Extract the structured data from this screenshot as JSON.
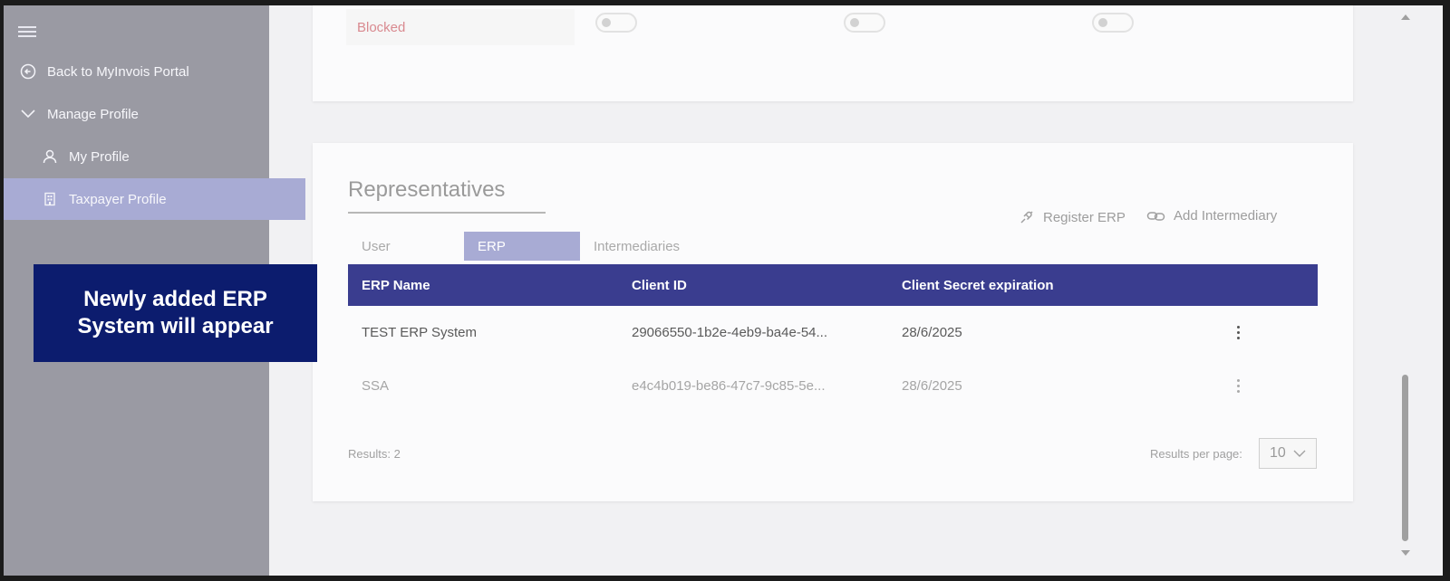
{
  "sidebar": {
    "menu_icon": "hamburger-icon",
    "items": [
      {
        "label": "Back to MyInvois Portal",
        "icon": "back-circle-icon"
      },
      {
        "label": "Manage Profile",
        "icon": "chevron-down-icon"
      },
      {
        "label": "My Profile",
        "icon": "person-icon"
      },
      {
        "label": "Taxpayer Profile",
        "icon": "building-icon"
      }
    ]
  },
  "caption": {
    "text": "Newly added ERP System will appear"
  },
  "top_card": {
    "status_value": "Blocked"
  },
  "representatives": {
    "title": "Representatives",
    "actions": {
      "register_erp": "Register ERP",
      "add_intermediary": "Add Intermediary"
    },
    "tabs": [
      "User",
      "ERP",
      "Intermediaries"
    ],
    "active_tab": "ERP",
    "table": {
      "headers": [
        "ERP Name",
        "Client ID",
        "Client Secret expiration"
      ],
      "rows": [
        {
          "name": "TEST ERP System",
          "client_id": "29066550-1b2e-4eb9-ba4e-54...",
          "expiration": "28/6/2025"
        },
        {
          "name": "SSA",
          "client_id": "e4c4b019-be86-47c7-9c85-5e...",
          "expiration": "28/6/2025"
        }
      ]
    },
    "results": "Results: 2",
    "results_per_page_label": "Results per page:",
    "results_per_page_value": "10"
  },
  "colors": {
    "sidebar_bg": "#9a9aa3",
    "active_highlight": "#a8abd4",
    "table_header": "#3a3d8f",
    "caption_bg": "#0c1c6e",
    "status_blocked": "#d98a90"
  }
}
